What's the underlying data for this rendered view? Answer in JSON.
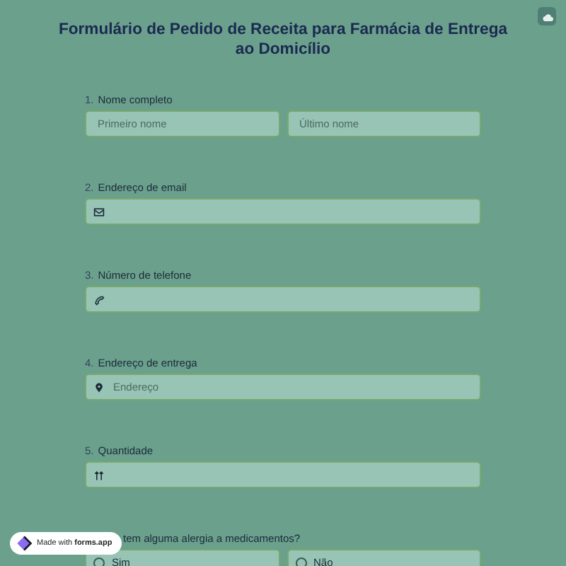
{
  "title": "Formulário de Pedido de Receita para Farmácia de Entrega ao Domicílio",
  "questions": [
    {
      "number": "1.",
      "label": "Nome completo",
      "kind": "name",
      "inputs": [
        {
          "placeholder": "Primeiro nome"
        },
        {
          "placeholder": "Último nome"
        }
      ]
    },
    {
      "number": "2.",
      "label": "Endereço de email",
      "kind": "email"
    },
    {
      "number": "3.",
      "label": "Número de telefone",
      "kind": "phone"
    },
    {
      "number": "4.",
      "label": "Endereço de entrega",
      "kind": "address",
      "placeholder": "Endereço"
    },
    {
      "number": "5.",
      "label": "Quantidade",
      "kind": "number"
    },
    {
      "label": "tem alguma alergia a medicamentos?",
      "kind": "choice",
      "options": [
        {
          "label": "Sim",
          "selected": false
        },
        {
          "label": "Não",
          "selected": false
        }
      ]
    }
  ],
  "badge": {
    "text": "Made with ",
    "brand": "forms.app"
  }
}
